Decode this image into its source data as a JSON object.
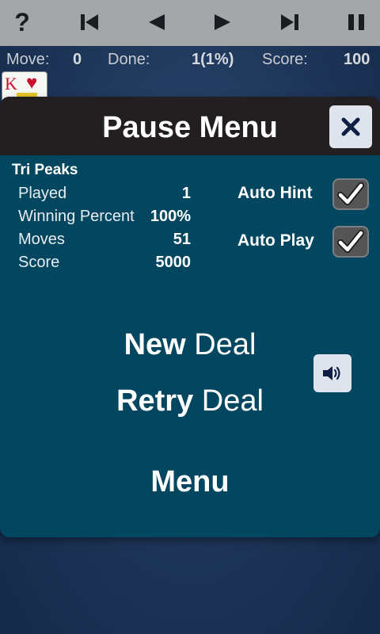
{
  "toolbar": {
    "buttons": [
      "help-icon",
      "skip-to-start-icon",
      "step-back-icon",
      "step-forward-icon",
      "skip-to-end-icon",
      "pause-icon"
    ],
    "help_glyph": "?"
  },
  "stats": {
    "move_label": "Move:",
    "move_value": "0",
    "done_label": "Done:",
    "done_value": "1(1%)",
    "score_label": "Score:",
    "score_value": "100"
  },
  "card": {
    "rank": "K",
    "suit": "♥"
  },
  "dialog": {
    "title": "Pause Menu",
    "game_name": "Tri Peaks",
    "stats": [
      {
        "label": "Played",
        "value": "1"
      },
      {
        "label": "Winning Percent",
        "value": "100%"
      },
      {
        "label": "Moves",
        "value": "51"
      },
      {
        "label": "Score",
        "value": "5000"
      }
    ],
    "toggles": [
      {
        "label": "Auto Hint",
        "checked": true
      },
      {
        "label": "Auto Play",
        "checked": true
      }
    ],
    "new_deal_bold": "New",
    "new_deal_light": " Deal",
    "retry_deal_bold": "Retry",
    "retry_deal_light": " Deal",
    "menu_label": "Menu"
  },
  "colors": {
    "toolbar_bg": "#a4a6a8",
    "dialog_bg": "#02475f",
    "dialog_header_bg": "#231f20",
    "background": "#1d3558"
  }
}
